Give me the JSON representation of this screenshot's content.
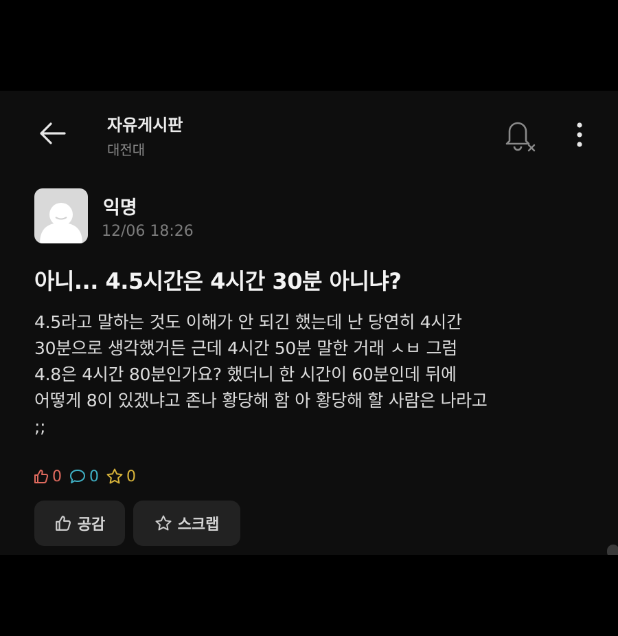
{
  "header": {
    "title": "자유게시판",
    "subtitle": "대전대",
    "icons": {
      "back": "arrow-left-icon",
      "notification": "bell-off-icon",
      "more": "more-vertical-icon"
    }
  },
  "post": {
    "author": "익명",
    "timestamp": "12/06 18:26",
    "title": "아니... 4.5시간은 4시간 30분 아니냐?",
    "body": "4.5라고 말하는 것도 이해가 안 되긴 했는데 난 당연히 4시간\n30분으로 생각했거든 근데 4시간 50분 말한 거래 ㅅㅂ 그럼\n4.8은 4시간 80분인가요? 했더니 한 시간이 60분인데 뒤에\n어떻게 8이 있겠냐고 존나 황당해 함 아 황당해 할 사람은 나라고\n;;",
    "counts": {
      "likes": "0",
      "comments": "0",
      "scraps": "0"
    }
  },
  "actions": {
    "like_label": "공감",
    "scrap_label": "스크랩"
  },
  "colors": {
    "background": "#0e0e0e",
    "like": "#e06a5e",
    "comment": "#3fb0c4",
    "scrap": "#d8b43a"
  }
}
